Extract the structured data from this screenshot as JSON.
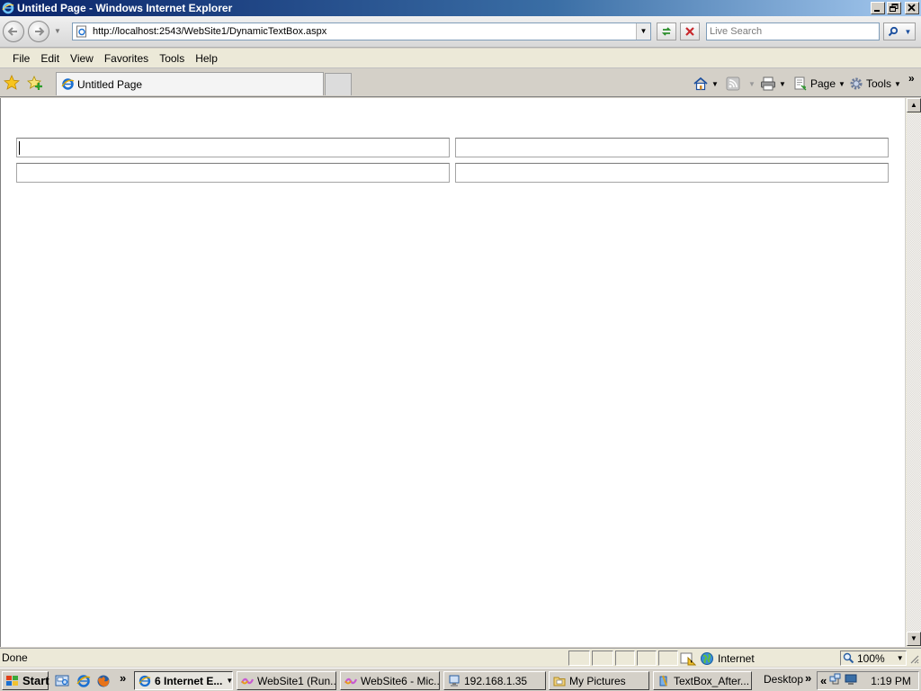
{
  "window": {
    "title": "Untitled Page - Windows Internet Explorer"
  },
  "address_bar": {
    "url": "http://localhost:2543/WebSite1/DynamicTextBox.aspx",
    "search_placeholder": "Live Search"
  },
  "menu": {
    "items": [
      "File",
      "Edit",
      "View",
      "Favorites",
      "Tools",
      "Help"
    ]
  },
  "tabs": [
    {
      "label": "Untitled Page"
    }
  ],
  "command_bar": {
    "page_label": "Page",
    "tools_label": "Tools",
    "overflow": "»"
  },
  "content": {
    "textboxes": [
      {
        "value": ""
      },
      {
        "value": ""
      },
      {
        "value": ""
      },
      {
        "value": ""
      }
    ]
  },
  "status_bar": {
    "status": "Done",
    "zone": "Internet",
    "zoom": "100%"
  },
  "taskbar": {
    "start_label": "Start",
    "overflow": "»",
    "tasks": [
      {
        "label": "6 Internet E...",
        "active": true
      },
      {
        "label": "WebSite1 (Run..."
      },
      {
        "label": "WebSite6 - Mic..."
      },
      {
        "label": "192.168.1.35"
      },
      {
        "label": "My Pictures"
      },
      {
        "label": "TextBox_After..."
      }
    ],
    "desktop_label": "Desktop",
    "desktop_overflow": "»",
    "tray_chevron": "«",
    "clock": "1:19 PM"
  },
  "colors": {
    "titlebar_start": "#0a246a",
    "titlebar_end": "#a6caf0",
    "chrome": "#d4d0c8",
    "ie_blue": "#1a6fd1"
  }
}
